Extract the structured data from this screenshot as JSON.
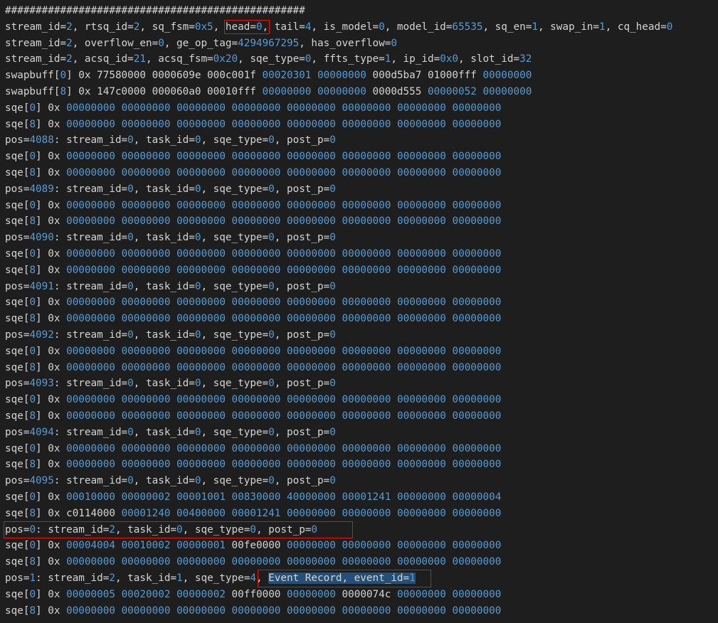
{
  "colors": {
    "background": "#1e1e1e",
    "text": "#d4d4d4",
    "number": "#569cd6",
    "highlight_orange": "#613214",
    "highlight_blue": "#264f78",
    "annotation_box": "#e51400"
  },
  "lines": [
    {
      "t": "#################################################"
    },
    {
      "t": "stream_id=2, rtsq_id=2, sq_fsm=0x5, head=0, tail=4, is_model=0, model_id=65535, sq_en=1, swap_in=1, cq_head=0"
    },
    {
      "t": "stream_id=2, overflow_en=0, ge_op_tag=4294967295, has_overflow=0"
    },
    {
      "t": "stream_id=2, acsq_id=21, acsq_fsm=0x20, sqe_type=0, ffts_type=1, ip_id=0x0, slot_id=32"
    },
    {
      "t": "swapbuff[0] 0x 77580000 0000609e 000c001f 00020301 00000000 000d5ba7 01000fff 00000000"
    },
    {
      "t": "swapbuff[8] 0x 147c0000 000060a0 00010fff 00000000 00000000 0000d555 00000052 00000000"
    },
    {
      "t": "sqe[0] 0x 00000000 00000000 00000000 00000000 00000000 00000000 00000000 00000000"
    },
    {
      "t": "sqe[8] 0x 00000000 00000000 00000000 00000000 00000000 00000000 00000000 00000000"
    },
    {
      "t": "pos=4088: stream_id=0, task_id=0, sqe_type=0, post_p=0"
    },
    {
      "t": "sqe[0] 0x 00000000 00000000 00000000 00000000 00000000 00000000 00000000 00000000"
    },
    {
      "t": "sqe[8] 0x 00000000 00000000 00000000 00000000 00000000 00000000 00000000 00000000"
    },
    {
      "t": "pos=4089: stream_id=0, task_id=0, sqe_type=0, post_p=0"
    },
    {
      "t": "sqe[0] 0x 00000000 00000000 00000000 00000000 00000000 00000000 00000000 00000000"
    },
    {
      "t": "sqe[8] 0x 00000000 00000000 00000000 00000000 00000000 00000000 00000000 00000000"
    },
    {
      "t": "pos=4090: stream_id=0, task_id=0, sqe_type=0, post_p=0"
    },
    {
      "t": "sqe[0] 0x 00000000 00000000 00000000 00000000 00000000 00000000 00000000 00000000"
    },
    {
      "t": "sqe[8] 0x 00000000 00000000 00000000 00000000 00000000 00000000 00000000 00000000"
    },
    {
      "t": "pos=4091: stream_id=0, task_id=0, sqe_type=0, post_p=0"
    },
    {
      "t": "sqe[0] 0x 00000000 00000000 00000000 00000000 00000000 00000000 00000000 00000000"
    },
    {
      "t": "sqe[8] 0x 00000000 00000000 00000000 00000000 00000000 00000000 00000000 00000000"
    },
    {
      "t": "pos=4092: stream_id=0, task_id=0, sqe_type=0, post_p=0"
    },
    {
      "t": "sqe[0] 0x 00000000 00000000 00000000 00000000 00000000 00000000 00000000 00000000"
    },
    {
      "t": "sqe[8] 0x 00000000 00000000 00000000 00000000 00000000 00000000 00000000 00000000"
    },
    {
      "t": "pos=4093: stream_id=0, task_id=0, sqe_type=0, post_p=0"
    },
    {
      "t": "sqe[0] 0x 00000000 00000000 00000000 00000000 00000000 00000000 00000000 00000000"
    },
    {
      "t": "sqe[8] 0x 00000000 00000000 00000000 00000000 00000000 00000000 00000000 00000000"
    },
    {
      "t": "pos=4094: stream_id=0, task_id=0, sqe_type=0, post_p=0"
    },
    {
      "t": "sqe[0] 0x 00000000 00000000 00000000 00000000 00000000 00000000 00000000 00000000"
    },
    {
      "t": "sqe[8] 0x 00000000 00000000 00000000 00000000 00000000 00000000 00000000 00000000"
    },
    {
      "t": "pos=4095: stream_id=0, task_id=0, sqe_type=0, post_p=0"
    },
    {
      "t": "sqe[0] 0x 00010000 00000002 00001001 00830000 40000000 00001241 00000000 00000004"
    },
    {
      "t": "sqe[8] 0x c0114000 00001240 00400000 00001241 00000000 00000000 00000000 00000000"
    },
    {
      "t": "pos=0: stream_id=2, task_id=0, sqe_type=0, post_p=0"
    },
    {
      "t": "sqe[0] 0x 00004004 00010002 00000001 00fe0000 00000000 00000000 00000000 00000000"
    },
    {
      "t": "sqe[8] 0x 00000000 00000000 00000000 00000000 00000000 00000000 00000000 00000000"
    },
    {
      "t": "pos=1: stream_id=2, task_id=1, sqe_type=4, Event Record, event_id=1"
    },
    {
      "t": "sqe[0] 0x 00000005 00020002 00000002 00ff0000 00000000 0000074c 00000000 00000000"
    },
    {
      "t": "sqe[8] 0x 00000000 00000000 00000000 00000000 00000000 00000000 00000000 00000000"
    }
  ],
  "orange_highlights": [
    {
      "line": 1,
      "text": "sq_fsm=0x"
    },
    {
      "line": 3,
      "text": "sq_fsm=0x"
    }
  ],
  "blue_highlights": [
    {
      "line": 35,
      "text": "Event Record, event_id=1"
    }
  ],
  "boxed_tokens": [
    {
      "line": 1,
      "text": "head=0,"
    }
  ],
  "boxed_segments": [
    {
      "line": 32,
      "text": "pos=0: stream_id=2, task_id=0, sqe_type=0, post_p=0"
    },
    {
      "line": 35,
      "text": "Event Record, event_id=1"
    }
  ]
}
